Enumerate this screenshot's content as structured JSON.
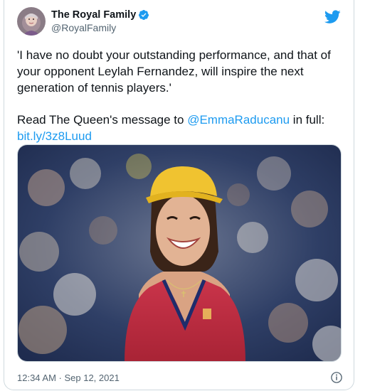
{
  "tweet": {
    "display_name": "The Royal Family",
    "handle": "@RoyalFamily",
    "quote": "'I have no doubt your outstanding performance, and that of your opponent Leylah Fernandez, will inspire the next generation of tennis players.'",
    "message_prefix": "Read The Queen's message to ",
    "mention": "@EmmaRaducanu",
    "message_suffix": " in full:",
    "link": "bit.ly/3z8Luud",
    "timestamp": "12:34 AM · Sep 12, 2021"
  },
  "icons": {
    "verified": "verified-badge-icon",
    "brand": "twitter-bird-icon",
    "info": "info-icon"
  },
  "colors": {
    "accent": "#1d9bf0",
    "text": "#0f1419",
    "muted": "#536471",
    "border": "#cfd9de"
  }
}
